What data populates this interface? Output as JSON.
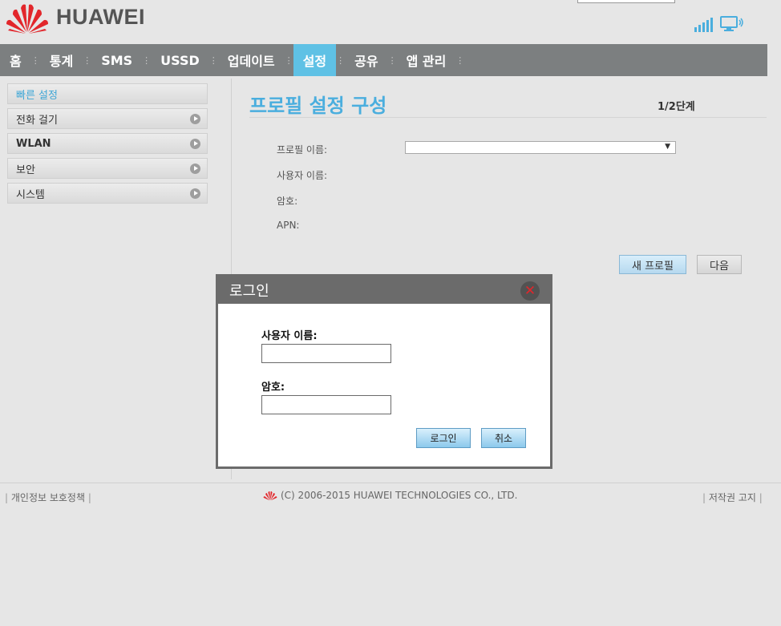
{
  "header": {
    "logo_text": "HUAWEI",
    "logo_icon": "huawei-flower-logo",
    "signal_icon": "signal-bars-icon",
    "connection_icon": "monitor-connection-icon"
  },
  "nav": {
    "items": [
      {
        "label": "홈"
      },
      {
        "label": "통계"
      },
      {
        "label": "SMS"
      },
      {
        "label": "USSD"
      },
      {
        "label": "업데이트"
      },
      {
        "label": "설정"
      },
      {
        "label": "공유"
      },
      {
        "label": "앱 관리"
      }
    ],
    "active_index": 5
  },
  "sidebar": {
    "items": [
      {
        "label": "빠른 설정"
      },
      {
        "label": "전화 걸기"
      },
      {
        "label": "WLAN"
      },
      {
        "label": "보안"
      },
      {
        "label": "시스템"
      }
    ]
  },
  "main": {
    "title": "프로필 설정 구성",
    "step": "1/2단계",
    "fields": {
      "profile_name": "프로필 이름:",
      "username": "사용자 이름:",
      "password": "암호:",
      "apn": "APN:"
    },
    "new_profile_button": "새 프로필",
    "next_button": "다음"
  },
  "dialog": {
    "title": "로그인",
    "username_label": "사용자 이름:",
    "password_label": "암호:",
    "login_button": "로그인",
    "cancel_button": "취소"
  },
  "footer": {
    "privacy": "개인정보 보호정책",
    "copyright": "(C) 2006-2015 HUAWEI TECHNOLOGIES CO., LTD.",
    "notice": "저작권 고지"
  },
  "colors": {
    "accent": "#4aaede",
    "nav_bg": "#7c7f80",
    "nav_active": "#5fc1e5",
    "logo_red": "#e2262b"
  }
}
